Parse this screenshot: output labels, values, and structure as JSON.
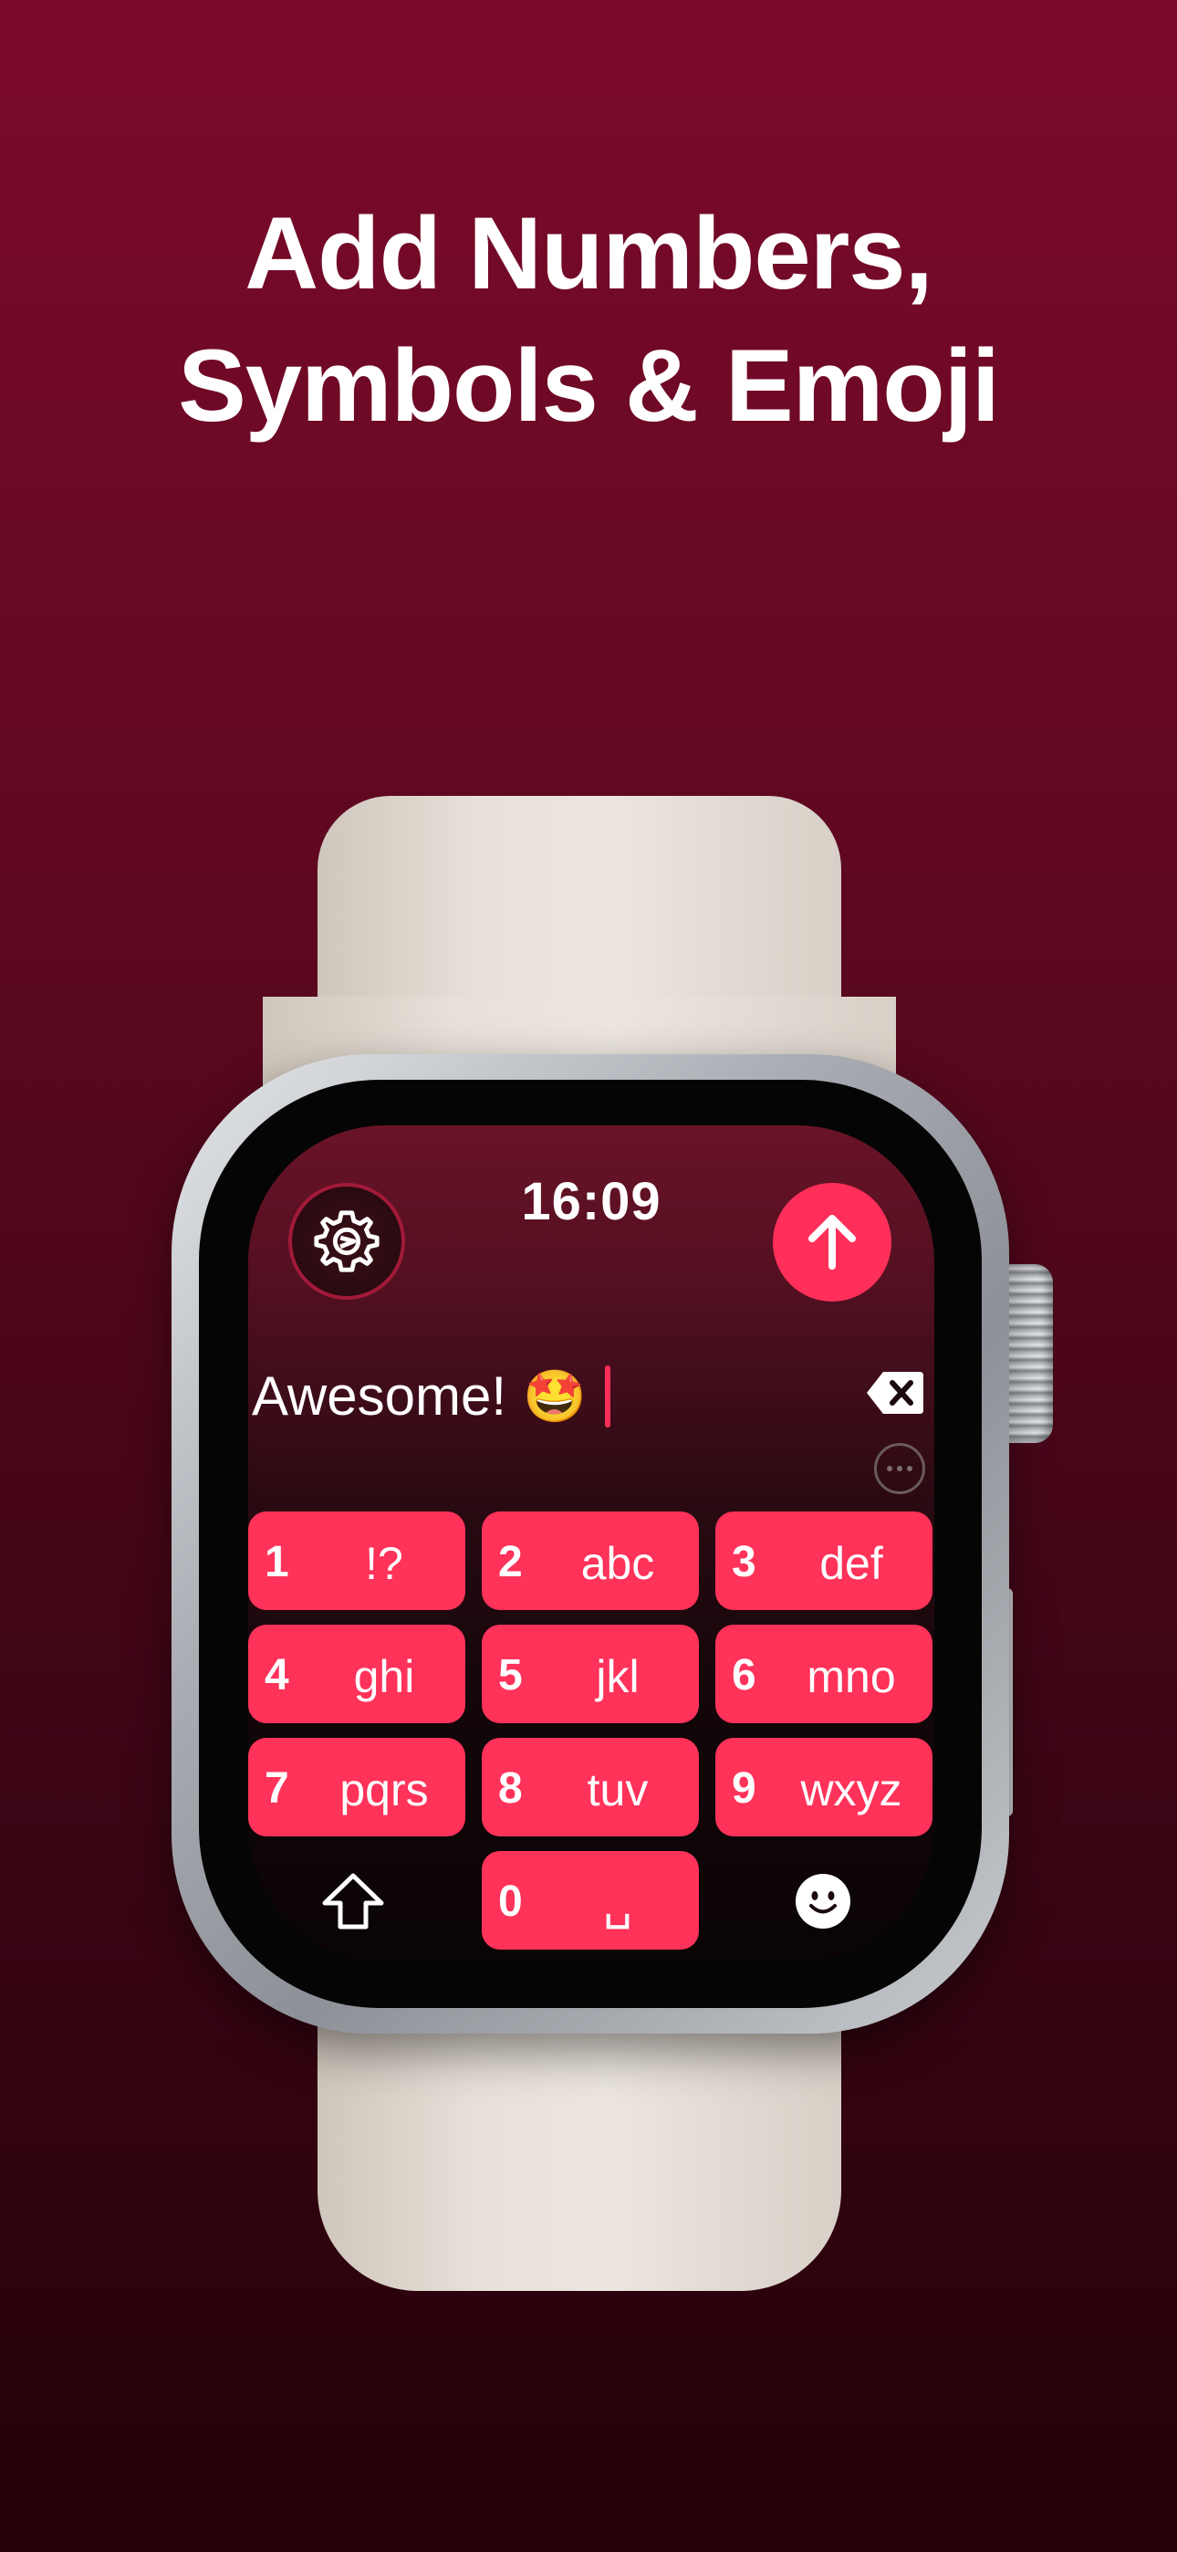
{
  "headline": {
    "line1": "Add Numbers,",
    "line2": "Symbols & Emoji"
  },
  "watch": {
    "time": "16:09",
    "text_field": {
      "text": "Awesome!",
      "emoji": "🤩"
    },
    "icons": {
      "settings": "gear-icon",
      "send": "arrow-up-icon",
      "delete": "delete-backward-icon",
      "more": "ellipsis-circle-icon",
      "shift": "shift-icon",
      "emoji": "smiley-face-icon"
    },
    "keys": [
      {
        "num": "1",
        "letters": "!?"
      },
      {
        "num": "2",
        "letters": "abc"
      },
      {
        "num": "3",
        "letters": "def"
      },
      {
        "num": "4",
        "letters": "ghi"
      },
      {
        "num": "5",
        "letters": "jkl"
      },
      {
        "num": "6",
        "letters": "mno"
      },
      {
        "num": "7",
        "letters": "pqrs"
      },
      {
        "num": "8",
        "letters": "tuv"
      },
      {
        "num": "9",
        "letters": "wxyz"
      },
      {
        "num": "0",
        "letters": "␣"
      }
    ],
    "colors": {
      "accent": "#ff325a",
      "background_top": "#7c0a2b",
      "background_bottom": "#250209"
    }
  }
}
